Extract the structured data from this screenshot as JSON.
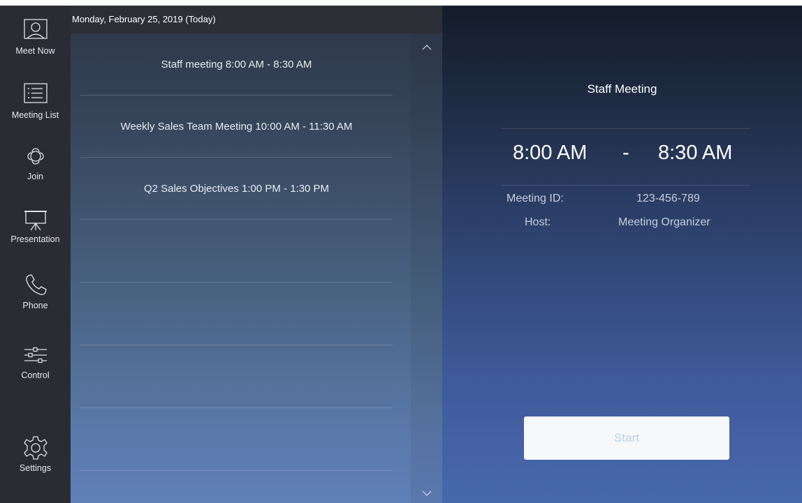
{
  "sidebar": {
    "items": [
      {
        "label": "Meet Now",
        "icon": "person-icon"
      },
      {
        "label": "Meeting List",
        "icon": "list-icon"
      },
      {
        "label": "Join",
        "icon": "join-icon"
      },
      {
        "label": "Presentation",
        "icon": "projector-screen-icon"
      },
      {
        "label": "Phone",
        "icon": "phone-icon"
      },
      {
        "label": "Control",
        "icon": "sliders-icon"
      },
      {
        "label": "Settings",
        "icon": "gear-icon"
      }
    ]
  },
  "meeting_list": {
    "date_header": "Monday, February 25, 2019 (Today)",
    "meetings": [
      "Staff meeting 8:00 AM - 8:30 AM",
      "Weekly Sales Team Meeting 10:00 AM - 11:30 AM",
      "Q2 Sales Objectives 1:00 PM - 1:30 PM"
    ],
    "scroll_up_icon": "chevron-up-icon",
    "scroll_down_icon": "chevron-down-icon"
  },
  "detail": {
    "title": "Staff Meeting",
    "start_time": "8:00 AM",
    "separator": "-",
    "end_time": "8:30 AM",
    "meeting_id_label": "Meeting ID:",
    "meeting_id_value": "123-456-789",
    "host_label": "Host:",
    "host_value": "Meeting Organizer",
    "start_button": "Start"
  },
  "colors": {
    "sidebar_bg": "#2a2c31",
    "header_bg": "#2d2f36",
    "start_button_text": "#b4d3ec"
  }
}
